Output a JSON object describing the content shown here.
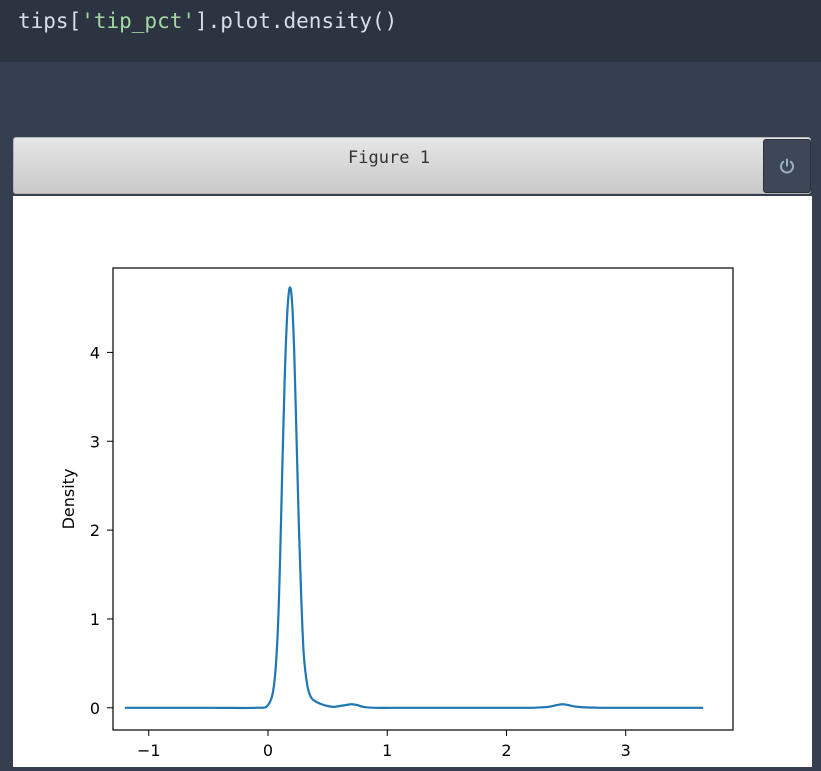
{
  "code": {
    "prefix": "tips[",
    "string": "'tip_pct'",
    "suffix": "].plot.density()"
  },
  "figure": {
    "title": "Figure 1",
    "power_icon": "power-icon"
  },
  "chart_data": {
    "type": "line",
    "title": "",
    "xlabel": "",
    "ylabel": "Density",
    "xlim": [
      -1.3,
      3.9
    ],
    "ylim": [
      -0.25,
      4.95
    ],
    "xticks": [
      -1,
      0,
      1,
      2,
      3
    ],
    "xtick_labels": [
      "−1",
      "0",
      "1",
      "2",
      "3"
    ],
    "yticks": [
      0,
      1,
      2,
      3,
      4
    ],
    "ytick_labels": [
      "0",
      "1",
      "2",
      "3",
      "4"
    ],
    "line_color": "#1f77b4",
    "series": [
      {
        "x": [
          -1.2,
          -0.5,
          -0.1,
          0.0,
          0.05,
          0.08,
          0.1,
          0.12,
          0.14,
          0.16,
          0.18,
          0.2,
          0.22,
          0.24,
          0.26,
          0.28,
          0.3,
          0.33,
          0.36,
          0.4,
          0.45,
          0.5,
          0.55,
          0.6,
          0.65,
          0.7,
          0.75,
          0.8,
          0.9,
          1.2,
          1.8,
          2.2,
          2.35,
          2.42,
          2.47,
          2.52,
          2.6,
          2.8,
          3.2,
          3.65
        ],
        "y": [
          0,
          0,
          0,
          0.03,
          0.25,
          0.8,
          1.6,
          2.7,
          3.7,
          4.4,
          4.72,
          4.6,
          4.0,
          3.0,
          2.0,
          1.2,
          0.6,
          0.25,
          0.12,
          0.07,
          0.04,
          0.02,
          0.01,
          0.02,
          0.03,
          0.04,
          0.03,
          0.01,
          0,
          0,
          0,
          0,
          0.01,
          0.03,
          0.04,
          0.03,
          0.01,
          0,
          0,
          0
        ]
      }
    ]
  }
}
